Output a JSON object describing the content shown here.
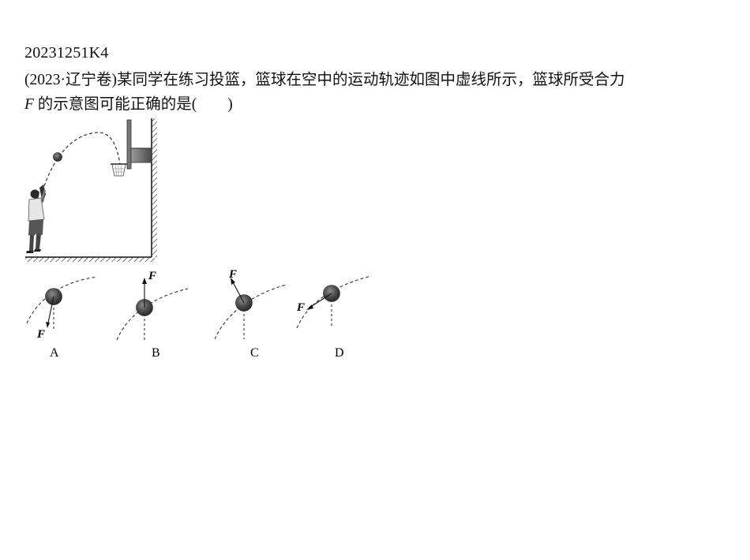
{
  "question": {
    "id": "20231251K4",
    "line1": "(2023·辽宁卷)某同学在练习投篮，篮球在空中的运动轨迹如图中虚线所示，篮球所受合力",
    "line2_italic": "F",
    "line2_rest": " 的示意图可能正确的是(　　)"
  },
  "options": [
    {
      "label": "A",
      "force_label": "F",
      "force_direction": "down-left"
    },
    {
      "label": "B",
      "force_label": "F",
      "force_direction": "up"
    },
    {
      "label": "C",
      "force_label": "F",
      "force_direction": "up-left"
    },
    {
      "label": "D",
      "force_label": "F",
      "force_direction": "left-down"
    }
  ]
}
